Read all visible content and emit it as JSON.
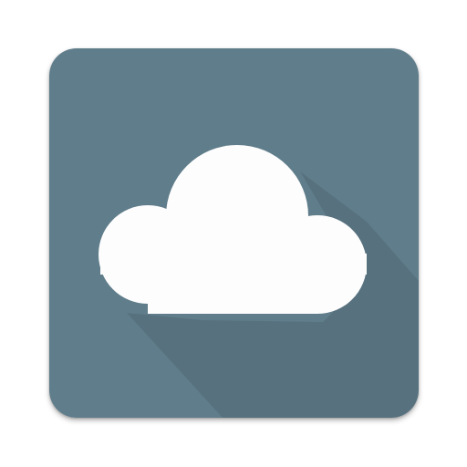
{
  "icon": {
    "name": "cloud-icon",
    "background_color": "#607d8b",
    "glyph_color": "#fdfdfd",
    "shadow_color": "#000000"
  }
}
